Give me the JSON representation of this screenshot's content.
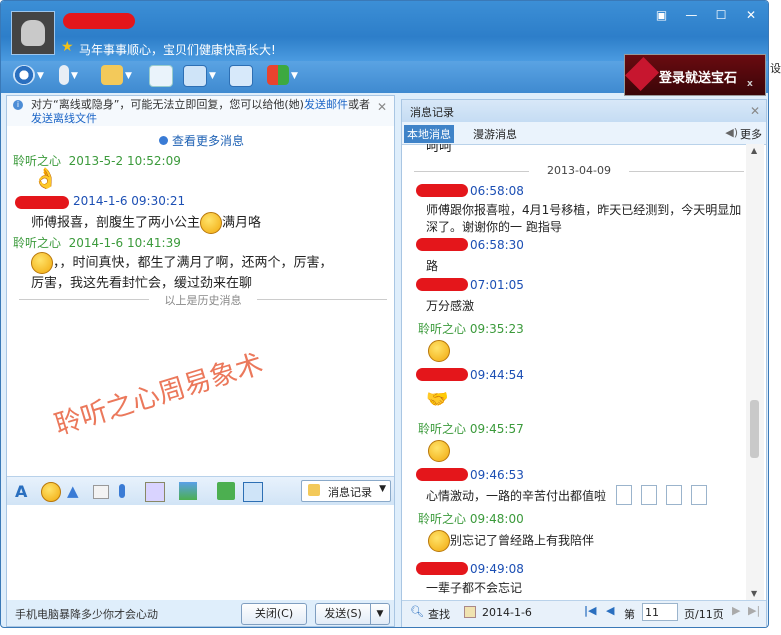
{
  "window": {
    "signature": "马年事事顺心，宝贝们健康快高长大!",
    "controls": [
      "▣",
      "—",
      "☐",
      "✕"
    ]
  },
  "ad": {
    "text": "登录就送宝石",
    "close": "x"
  },
  "bg_text": "设",
  "left": {
    "notice": {
      "prefix": "对方“离线或隐身”，可能无法立即回复，您可以给他(她)",
      "link1": "发送邮件",
      "mid": "或者",
      "link2": "发送离线文件"
    },
    "more_link": "查看更多消息",
    "messages": [
      {
        "name": "聆听之心",
        "time": "2013-5-2 10:52:09"
      },
      {
        "name": "",
        "time": "2014-1-6 09:30:21",
        "text_a": "师傅报喜，剖腹生了两小公主",
        "text_b": "满月咯"
      },
      {
        "name": "聆听之心",
        "time": "2014-1-6 10:41:39",
        "text_a": "，，时间真快，都生了满月了啊，还两个，厉害，",
        "text_b": "厉害，我这先看封忙会，缓过劲来在聊"
      }
    ],
    "history_divider": "以上是历史消息",
    "watermark": "聆听之心周易象术",
    "record_button": "消息记录",
    "bottom_ad": "手机电脑暴降多少你才会心动",
    "close_button": "关闭(C)",
    "send_button": "发送(S)"
  },
  "right": {
    "title": "消息记录",
    "tabs": [
      "本地消息",
      "漫游消息"
    ],
    "more": "更多",
    "top_partial": "呵呵",
    "date": "2013-04-09",
    "messages": [
      {
        "name": "",
        "time": "06:58:08",
        "text": "师傅跟你报喜啦，4月1号移植，昨天已经测到，今天明显加深了。谢谢你的一 跑指导"
      },
      {
        "name": "",
        "time": "06:58:30",
        "text": "路"
      },
      {
        "name": "",
        "time": "07:01:05",
        "text": "万分感激"
      },
      {
        "name": "聆听之心",
        "time": "09:35:23",
        "text": ""
      },
      {
        "name": "",
        "time": "09:44:54",
        "text": ""
      },
      {
        "name": "聆听之心",
        "time": "09:45:57",
        "text": ""
      },
      {
        "name": "",
        "time": "09:46:53",
        "text": "心情激动，一路的辛苦付出都值啦"
      },
      {
        "name": "聆听之心",
        "time": "09:48:00",
        "text": "别忘记了曾经路上有我陪伴"
      },
      {
        "name": "",
        "time": "09:49:08",
        "text": "一辈子都不会忘记"
      }
    ],
    "footer": {
      "search": "查找",
      "date": "2014-1-6",
      "page_prefix": "第",
      "page": "11",
      "page_suffix": "页/11页"
    }
  }
}
